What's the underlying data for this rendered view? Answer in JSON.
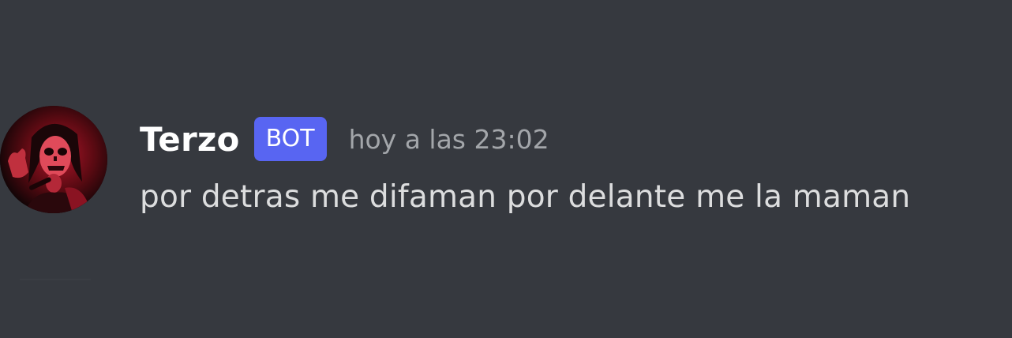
{
  "message": {
    "author": {
      "name": "Terzo",
      "tag": "BOT",
      "avatar_icon": "ghost-singer-avatar"
    },
    "timestamp": "hoy a las 23:02",
    "content": "por detras me difaman por delante me la maman"
  },
  "colors": {
    "background": "#36393f",
    "username": "#ffffff",
    "bot_tag": "#5865f2",
    "timestamp": "#a3a6aa",
    "message_text": "#dcddde"
  }
}
